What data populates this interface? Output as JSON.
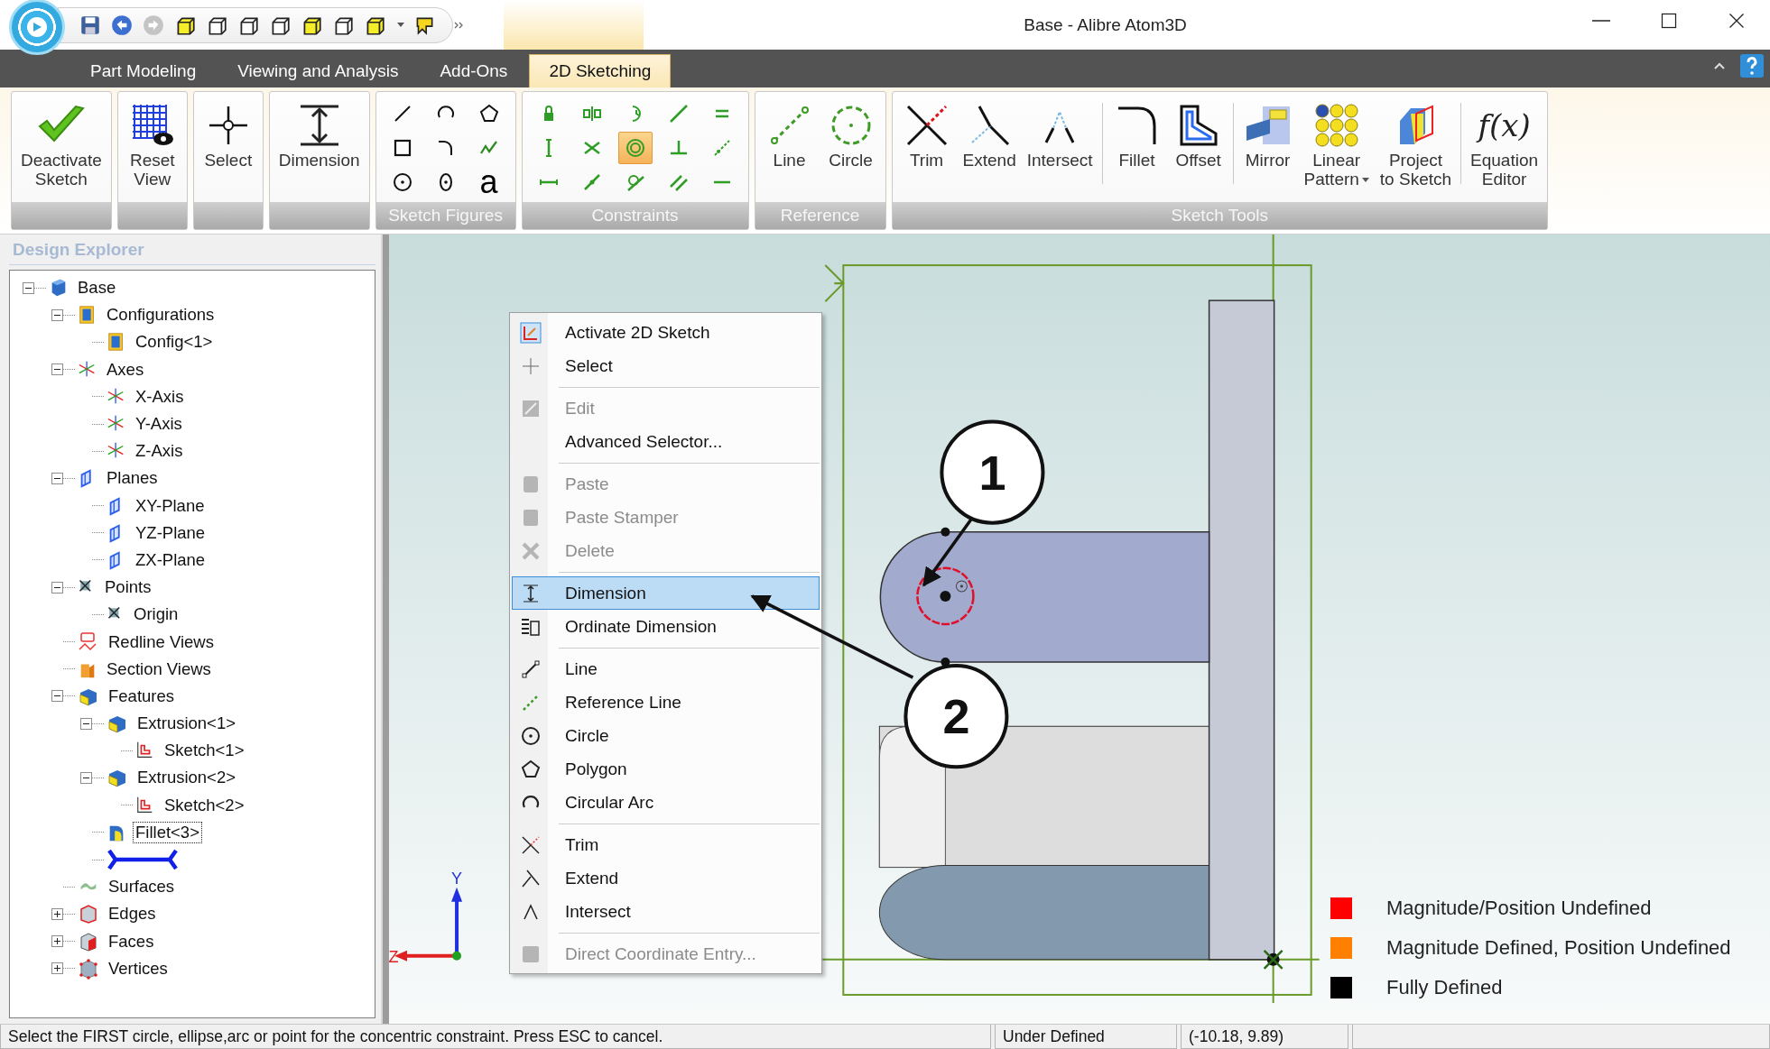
{
  "window": {
    "title": "Base - Alibre Atom3D"
  },
  "tabs": [
    {
      "label": "Part Modeling",
      "selected": false
    },
    {
      "label": "Viewing and Analysis",
      "selected": false
    },
    {
      "label": "Add-Ons",
      "selected": false
    },
    {
      "label": "2D Sketching",
      "selected": true
    }
  ],
  "ribbon_groups": [
    {
      "kind": "large",
      "sections": [
        [
          {
            "label": "Deactivate\nSketch",
            "dropdown": false
          }
        ]
      ]
    },
    {
      "kind": "large",
      "sections": [
        [
          {
            "label": "Reset\nView",
            "dropdown": false
          }
        ]
      ]
    },
    {
      "kind": "large",
      "sections": [
        [
          {
            "label": "Select",
            "dropdown": false
          }
        ]
      ]
    },
    {
      "kind": "large",
      "sections": [
        [
          {
            "label": "Dimension",
            "dropdown": false
          }
        ]
      ]
    },
    {
      "kind": "grid",
      "label": "Sketch Figures",
      "text_tool": "a",
      "tools": [
        {
          "selected": false
        },
        {
          "selected": false
        },
        {
          "selected": false
        },
        {
          "selected": false
        },
        {
          "selected": false
        },
        {
          "selected": false
        },
        {
          "selected": false
        },
        {
          "selected": false
        }
      ]
    },
    {
      "kind": "grid",
      "label": "Constraints",
      "tools": [
        {
          "selected": false
        },
        {
          "selected": false
        },
        {
          "selected": false
        },
        {
          "selected": false
        },
        {
          "selected": false
        },
        {
          "selected": false
        },
        {
          "selected": false
        },
        {
          "selected": true
        },
        {
          "selected": false
        },
        {
          "selected": false
        },
        {
          "selected": false
        },
        {
          "selected": false
        },
        {
          "selected": false
        },
        {
          "selected": false
        },
        {
          "selected": false
        }
      ]
    },
    {
      "kind": "large",
      "label": "Reference",
      "sections": [
        [
          {
            "label": "Line",
            "dropdown": false
          },
          {
            "label": "Circle",
            "dropdown": false
          }
        ]
      ]
    },
    {
      "kind": "large",
      "label": "Sketch Tools",
      "sections": [
        [
          {
            "label": "Trim",
            "dropdown": false
          },
          {
            "label": "Extend",
            "dropdown": false
          },
          {
            "label": "Intersect",
            "dropdown": false
          }
        ],
        [
          {
            "label": "Fillet",
            "dropdown": false
          },
          {
            "label": "Offset",
            "dropdown": false
          }
        ],
        [
          {
            "label": "Mirror",
            "dropdown": false
          },
          {
            "label": "Linear\nPattern",
            "dropdown": true
          },
          {
            "label": "Project\nto Sketch",
            "dropdown": false
          }
        ],
        [
          {
            "label": "Equation\nEditor",
            "dropdown": false,
            "icon_text": "f(x)"
          }
        ]
      ]
    }
  ],
  "explorer": {
    "title": "Design Explorer",
    "tree": [
      {
        "label": "Base",
        "kind": "node",
        "expanded": true,
        "selected": false,
        "children": [
          {
            "label": "Configurations",
            "kind": "node",
            "expanded": true,
            "selected": false,
            "children": [
              {
                "label": "Config<1>",
                "kind": "node",
                "selected": false
              }
            ]
          },
          {
            "label": "Axes",
            "kind": "node",
            "expanded": true,
            "selected": false,
            "children": [
              {
                "label": "X-Axis",
                "kind": "node",
                "selected": false
              },
              {
                "label": "Y-Axis",
                "kind": "node",
                "selected": false
              },
              {
                "label": "Z-Axis",
                "kind": "node",
                "selected": false
              }
            ]
          },
          {
            "label": "Planes",
            "kind": "node",
            "expanded": true,
            "selected": false,
            "children": [
              {
                "label": "XY-Plane",
                "kind": "node",
                "selected": false
              },
              {
                "label": "YZ-Plane",
                "kind": "node",
                "selected": false
              },
              {
                "label": "ZX-Plane",
                "kind": "node",
                "selected": false
              }
            ]
          },
          {
            "label": "Points",
            "kind": "node",
            "expanded": true,
            "selected": false,
            "children": [
              {
                "label": "Origin",
                "kind": "node",
                "selected": false
              }
            ]
          },
          {
            "label": "Redline Views",
            "kind": "node",
            "selected": false
          },
          {
            "label": "Section Views",
            "kind": "node",
            "selected": false
          },
          {
            "label": "Features",
            "kind": "node",
            "expanded": true,
            "selected": false,
            "children": [
              {
                "label": "Extrusion<1>",
                "kind": "node",
                "expanded": true,
                "selected": false,
                "children": [
                  {
                    "label": "Sketch<1>",
                    "kind": "node",
                    "selected": false
                  }
                ]
              },
              {
                "label": "Extrusion<2>",
                "kind": "node",
                "expanded": true,
                "selected": false,
                "children": [
                  {
                    "label": "Sketch<2>",
                    "kind": "node",
                    "selected": false
                  }
                ]
              },
              {
                "label": "Fillet<3>",
                "kind": "node",
                "selected": true
              },
              {
                "kind": "rollback_marker",
                "selected": false
              }
            ]
          },
          {
            "label": "Surfaces",
            "kind": "node",
            "selected": false
          },
          {
            "label": "Edges",
            "kind": "node",
            "expanded": false,
            "selected": false
          },
          {
            "label": "Faces",
            "kind": "node",
            "expanded": false,
            "selected": false
          },
          {
            "label": "Vertices",
            "kind": "node",
            "expanded": false,
            "selected": false
          }
        ]
      }
    ]
  },
  "viewport": {
    "callouts": [
      "1",
      "2"
    ],
    "axes": {
      "y": "Y",
      "z": "Z"
    },
    "context_menu": {
      "sections": [
        [
          {
            "label": "Activate 2D Sketch",
            "disabled": false,
            "selected": false
          },
          {
            "label": "Select",
            "disabled": false,
            "selected": false
          }
        ],
        [
          {
            "label": "Edit",
            "disabled": true,
            "selected": false
          },
          {
            "label": "Advanced Selector...",
            "disabled": false,
            "selected": false
          }
        ],
        [
          {
            "label": "Paste",
            "disabled": true,
            "selected": false
          },
          {
            "label": "Paste Stamper",
            "disabled": true,
            "selected": false
          },
          {
            "label": "Delete",
            "disabled": true,
            "selected": false
          }
        ],
        [
          {
            "label": "Dimension",
            "disabled": false,
            "selected": true
          },
          {
            "label": "Ordinate Dimension",
            "disabled": false,
            "selected": false
          }
        ],
        [
          {
            "label": "Line",
            "disabled": false,
            "selected": false
          },
          {
            "label": "Reference Line",
            "disabled": false,
            "selected": false
          },
          {
            "label": "Circle",
            "disabled": false,
            "selected": false
          },
          {
            "label": "Polygon",
            "disabled": false,
            "selected": false
          },
          {
            "label": "Circular Arc",
            "disabled": false,
            "selected": false
          }
        ],
        [
          {
            "label": "Trim",
            "disabled": false,
            "selected": false
          },
          {
            "label": "Extend",
            "disabled": false,
            "selected": false
          },
          {
            "label": "Intersect",
            "disabled": false,
            "selected": false
          }
        ],
        [
          {
            "label": "Direct Coordinate Entry...",
            "disabled": true,
            "selected": false
          }
        ]
      ]
    },
    "legend": [
      {
        "label": "Magnitude/Position Undefined",
        "color": "#ff0000"
      },
      {
        "label": "Magnitude Defined, Position Undefined",
        "color": "#ff8000"
      },
      {
        "label": "Fully Defined",
        "color": "#000000"
      }
    ]
  },
  "status_bar": {
    "message": "Select the FIRST circle, ellipse,arc or point for the concentric constraint. Press ESC to cancel.",
    "state": "Under Defined",
    "coordinates": "(-10.18, 9.89)"
  }
}
